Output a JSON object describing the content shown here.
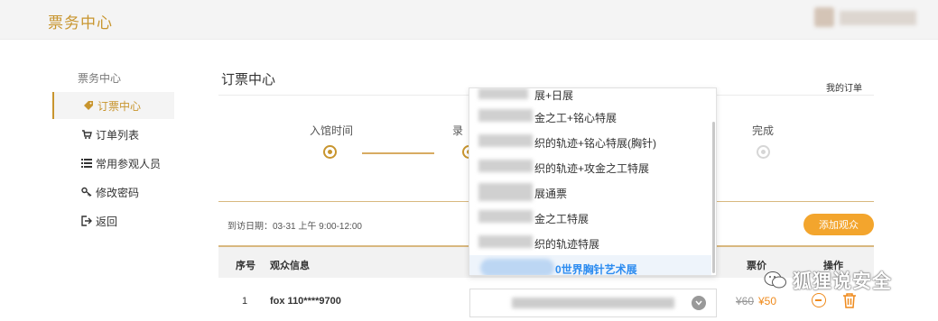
{
  "header": {
    "brand": "票务中心"
  },
  "sidebar": {
    "heading": "票务中心",
    "items": [
      {
        "label": "订票中心",
        "icon": "tag-icon",
        "active": true
      },
      {
        "label": "订单列表",
        "icon": "cart-icon"
      },
      {
        "label": "常用参观人员",
        "icon": "list-icon"
      },
      {
        "label": "修改密码",
        "icon": "key-icon"
      },
      {
        "label": "返回",
        "icon": "exit-icon"
      }
    ]
  },
  "main": {
    "title": "订票中心",
    "my_orders_link": "我的订单",
    "steps": [
      {
        "label": "入馆时间",
        "state": "done"
      },
      {
        "label": "录",
        "state": "done"
      },
      {
        "label": "完成",
        "state": "pending"
      }
    ],
    "visit_date": "到访日期：03-31 上午 9:00-12:00",
    "add_visitor_button": "添加观众",
    "table": {
      "headers": [
        "序号",
        "观众信息",
        "票价",
        "操作"
      ],
      "rows": [
        {
          "index": "1",
          "visitor": "fox 110****9700",
          "old_price": "¥60",
          "new_price": "¥50"
        }
      ]
    }
  },
  "dropdown": {
    "options": [
      "展+日展",
      "金之工+铭心特展",
      "织的轨迹+铭心特展(胸针)",
      "织的轨迹+攻金之工特展",
      "展通票",
      "金之工特展",
      "织的轨迹特展",
      "0世界胸针艺术展"
    ],
    "selected_index": 7
  },
  "watermark": {
    "text": "狐狸说安全"
  },
  "colors": {
    "accent": "#c8952e",
    "orange": "#f3a52d",
    "link_blue": "#2d8cf0"
  }
}
